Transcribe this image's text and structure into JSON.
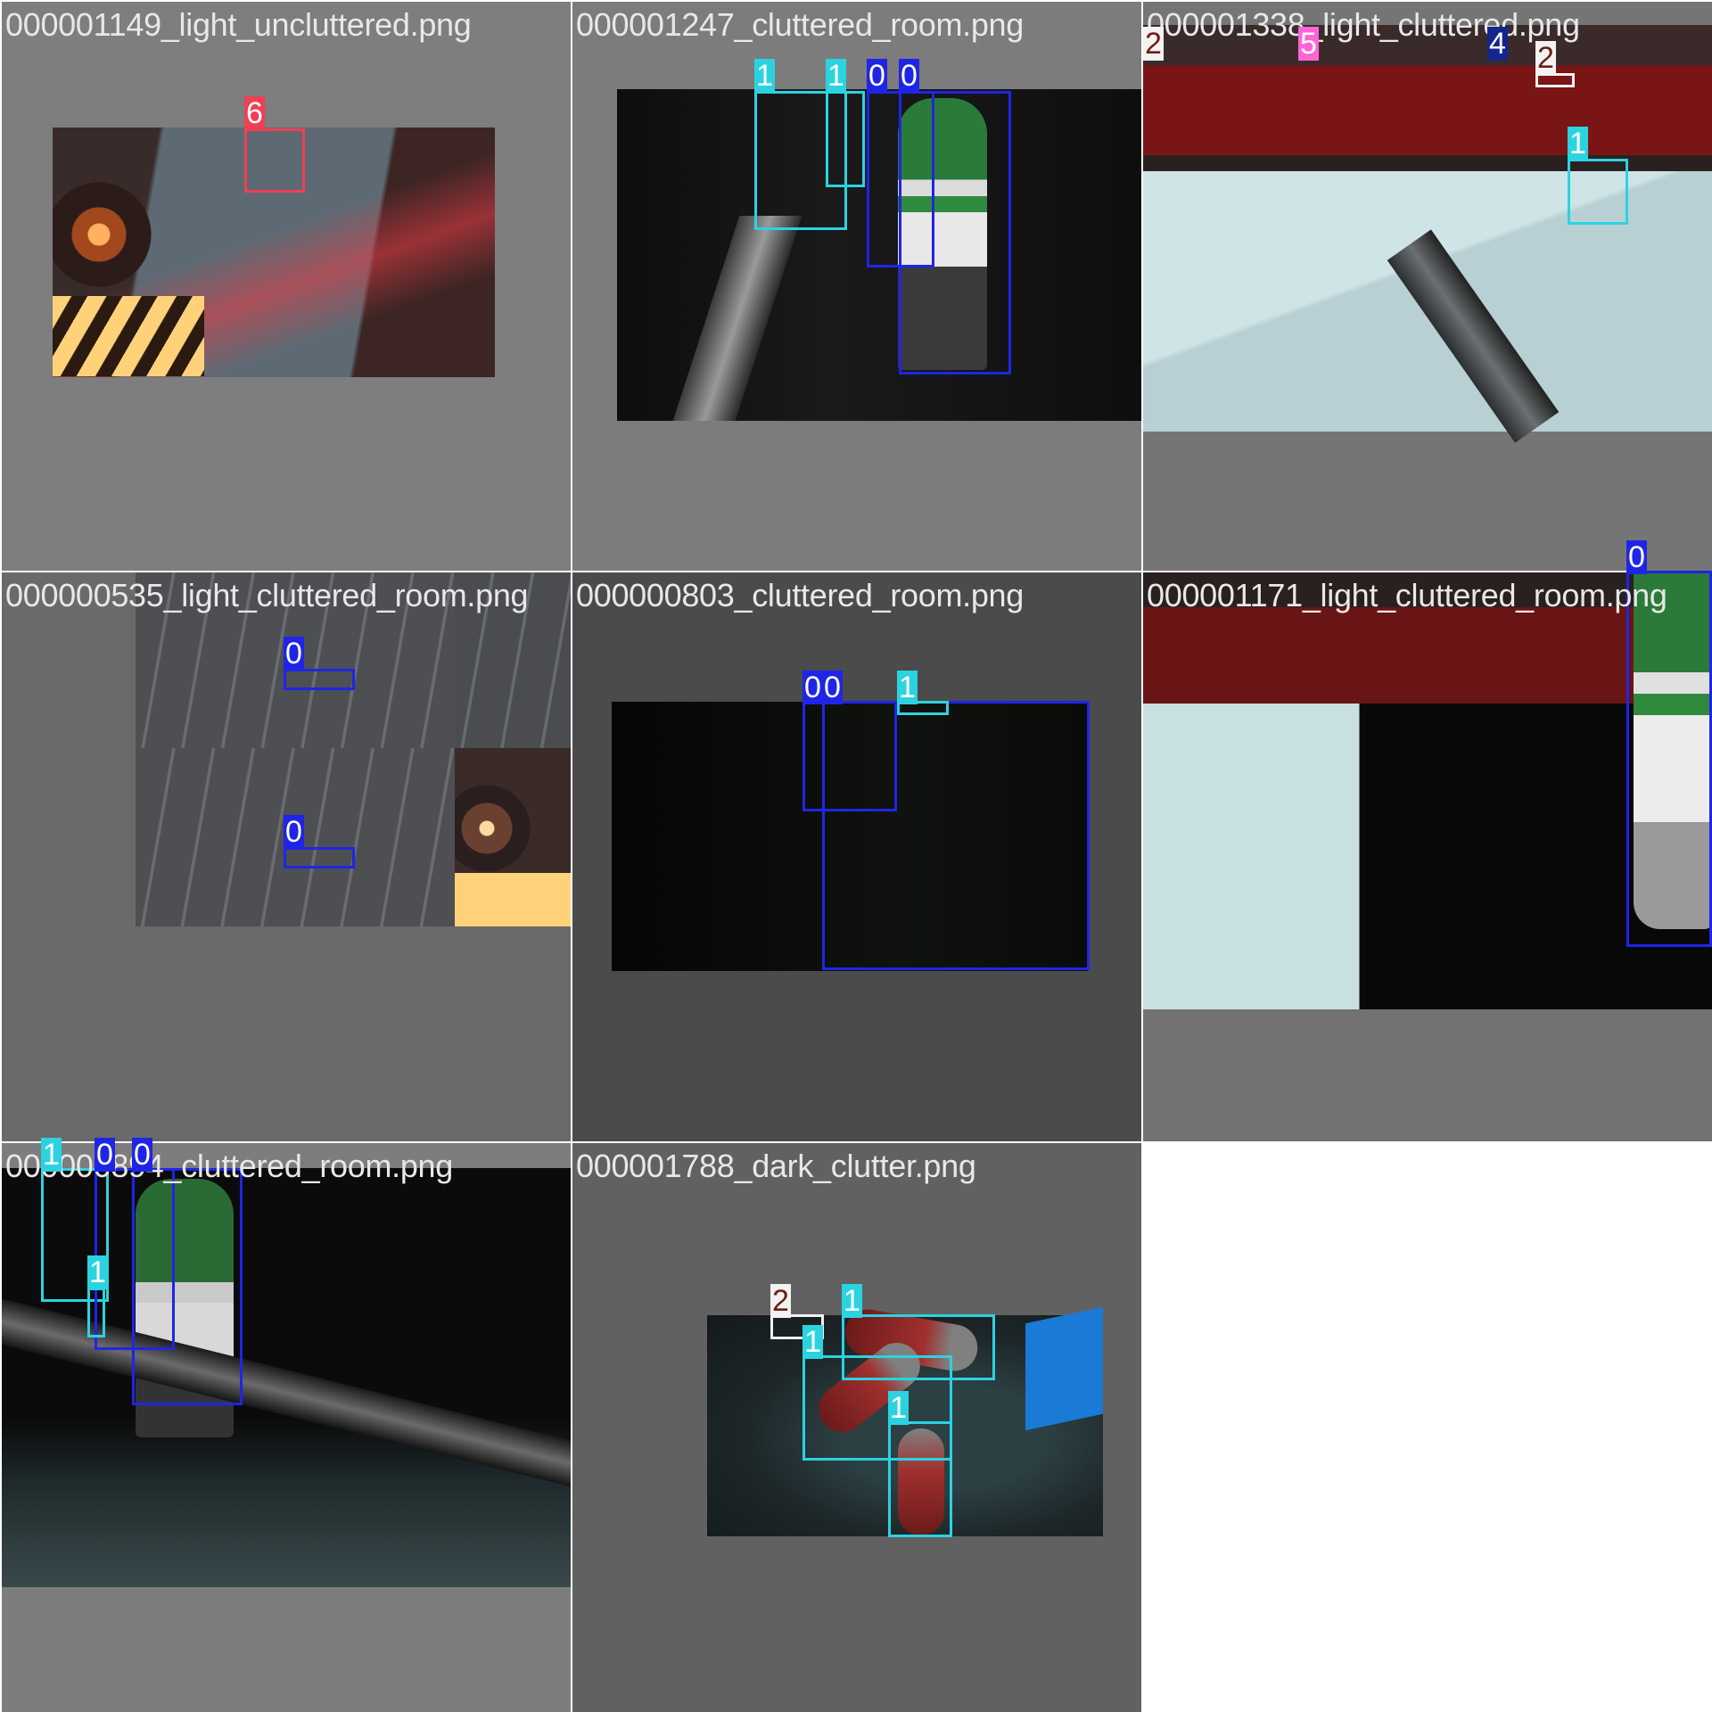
{
  "tiles": [
    {
      "filename": "000001149_light_uncluttered.png",
      "bg": "#7e7e7e",
      "detections": [
        {
          "cls": 6,
          "label": "6"
        }
      ]
    },
    {
      "filename": "000001247_cluttered_room.png",
      "bg": "#7c7c7c",
      "detections": [
        {
          "cls": 1,
          "label": "1"
        },
        {
          "cls": 1,
          "label": "1"
        },
        {
          "cls": 0,
          "label": "0"
        },
        {
          "cls": 0,
          "label": "0"
        }
      ]
    },
    {
      "filename": "000001338_light_cluttered.png",
      "bg": "#757575",
      "detections": [
        {
          "cls": 2,
          "label": "2"
        },
        {
          "cls": 5,
          "label": "5"
        },
        {
          "cls": 4,
          "label": "4"
        },
        {
          "cls": 2,
          "label": "2"
        },
        {
          "cls": 1,
          "label": "1"
        }
      ]
    },
    {
      "filename": "000000535_light_cluttered_room.png",
      "bg": "#6a6a6a",
      "detections": [
        {
          "cls": 0,
          "label": "0"
        },
        {
          "cls": 0,
          "label": "0"
        }
      ]
    },
    {
      "filename": "000000803_cluttered_room.png",
      "bg": "#4b4b4b",
      "detections": [
        {
          "cls": 0,
          "label": "0"
        },
        {
          "cls": 0,
          "label": "0"
        },
        {
          "cls": 1,
          "label": "1"
        }
      ]
    },
    {
      "filename": "000001171_light_cluttered_room.png",
      "bg": "#727272",
      "detections": [
        {
          "cls": 0,
          "label": "0"
        }
      ]
    },
    {
      "filename": "000000894_cluttered_room.png",
      "bg": "#7d7d7d",
      "detections": [
        {
          "cls": 1,
          "label": "1"
        },
        {
          "cls": 0,
          "label": "0"
        },
        {
          "cls": 0,
          "label": "0"
        },
        {
          "cls": 1,
          "label": "1"
        }
      ]
    },
    {
      "filename": "000001788_dark_clutter.png",
      "bg": "#616161",
      "detections": [
        {
          "cls": 2,
          "label": "2"
        },
        {
          "cls": 1,
          "label": "1"
        },
        {
          "cls": 1,
          "label": "1"
        },
        {
          "cls": 1,
          "label": "1"
        }
      ]
    }
  ],
  "class_colors": {
    "0": "#1f25e6",
    "1": "#2bd3e0",
    "2": "#f2f2f2",
    "4": "#13268f",
    "5": "#ff64d6",
    "6": "#ef3f55"
  }
}
